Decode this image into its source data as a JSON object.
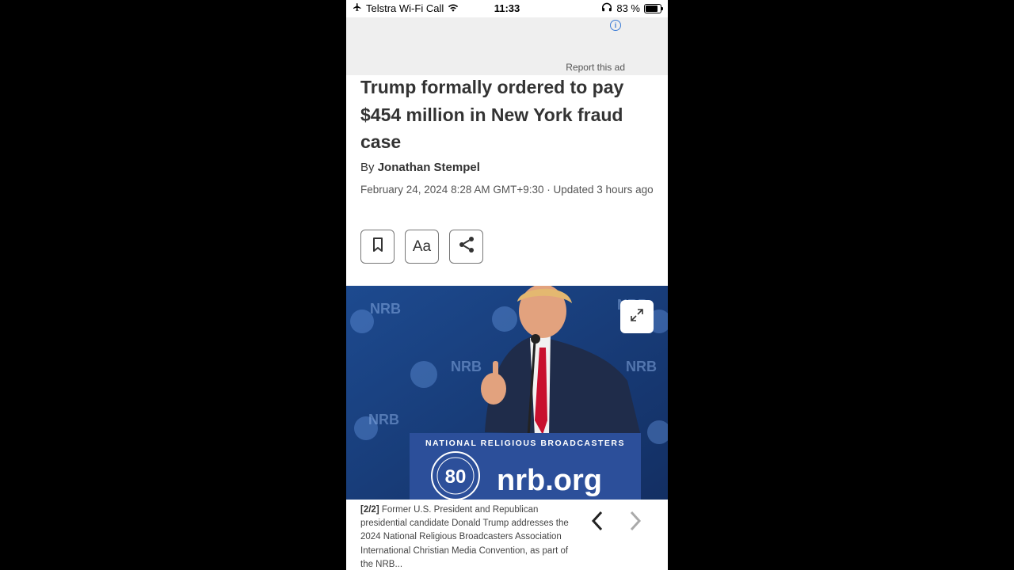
{
  "status_bar": {
    "carrier": "Telstra Wi-Fi Call",
    "time": "11:33",
    "battery": "83 %",
    "icons": [
      "airplane-icon",
      "wifi-icon",
      "headphones-icon",
      "battery-icon"
    ]
  },
  "ad": {
    "report_label": "Report this ad",
    "info_glyph": "i"
  },
  "article": {
    "headline": "Trump formally ordered to pay $454 million in New York fraud case",
    "byline_prefix": "By",
    "author": "Jonathan Stempel",
    "dateline": "February 24, 2024 8:28 AM GMT+9:30 · Updated 3 hours ago",
    "tools": {
      "bookmark_icon": "bookmark-icon",
      "text_size_label": "Aa",
      "share_icon": "share-icon"
    }
  },
  "photo": {
    "podium_banner": "NATIONAL RELIGIOUS BROADCASTERS",
    "podium_site": "nrb.org",
    "backdrop_text": "NRB",
    "badge_text": "80",
    "expand_icon": "expand-icon"
  },
  "caption": {
    "counter": "[2/2]",
    "text": "Former U.S. President and Republican presidential candidate Donald Trump addresses the 2024 National Religious Broadcasters Association International Christian Media Convention, as part of the NRB...",
    "prev_icon": "chevron-left-icon",
    "next_icon": "chevron-right-icon"
  },
  "colors": {
    "photo_blue": "#1a3d7c",
    "podium_blue": "#2c4f9a",
    "tie_red": "#c8102e"
  }
}
